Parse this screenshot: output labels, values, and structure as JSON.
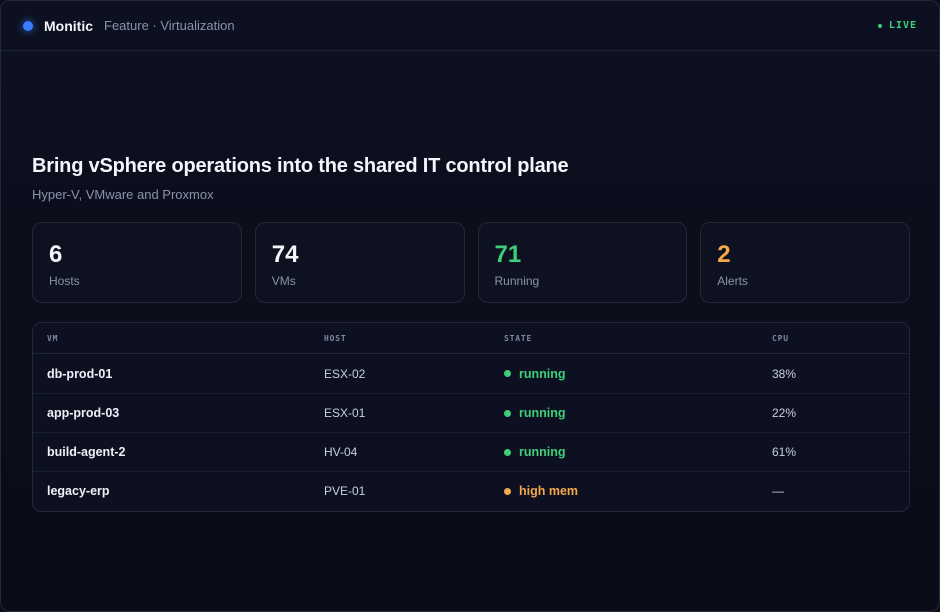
{
  "header": {
    "brand": "Monitic",
    "breadcrumb": "Feature · Virtualization",
    "live_label": "LIVE"
  },
  "hero": {
    "title": "Bring vSphere operations into the shared IT control plane",
    "subtitle": "Hyper-V, VMware and Proxmox"
  },
  "stats": [
    {
      "value": "6",
      "label": "Hosts",
      "color": "#f4f6fc"
    },
    {
      "value": "74",
      "label": "VMs",
      "color": "#f4f6fc"
    },
    {
      "value": "71",
      "label": "Running",
      "color": "#3ecf7a"
    },
    {
      "value": "2",
      "label": "Alerts",
      "color": "#f5a84a"
    }
  ],
  "table": {
    "columns": {
      "vm": "VM",
      "host": "HOST",
      "state": "STATE",
      "cpu": "CPU"
    },
    "rows": [
      {
        "vm": "db-prod-01",
        "host": "ESX-02",
        "state": "running",
        "state_color": "#3ecf7a",
        "cpu": "38%"
      },
      {
        "vm": "app-prod-03",
        "host": "ESX-01",
        "state": "running",
        "state_color": "#3ecf7a",
        "cpu": "22%"
      },
      {
        "vm": "build-agent-2",
        "host": "HV-04",
        "state": "running",
        "state_color": "#3ecf7a",
        "cpu": "61%"
      },
      {
        "vm": "legacy-erp",
        "host": "PVE-01",
        "state": "high mem",
        "state_color": "#f5a84a",
        "cpu": "—"
      }
    ]
  },
  "colors": {
    "accent": "#3b7bff",
    "live": "#3ecf7a",
    "running": "#3ecf7a",
    "warning": "#f5a84a"
  }
}
